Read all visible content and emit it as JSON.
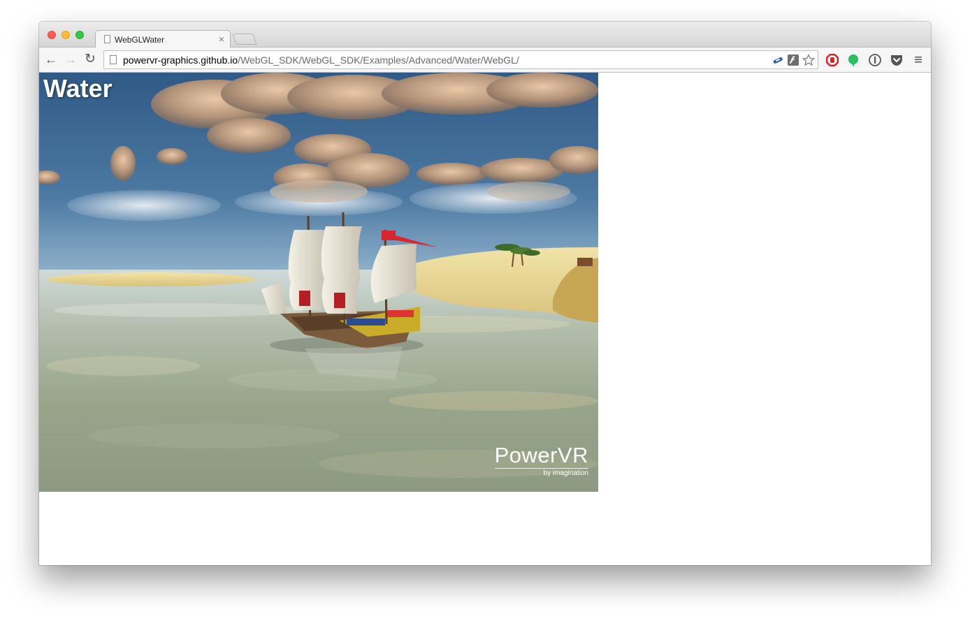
{
  "browser": {
    "tab_title": "WebGLWater",
    "tab_close": "×",
    "url_host": "powervr-graphics.github.io",
    "url_path": "/WebGL_SDK/WebGL_SDK/Examples/Advanced/Water/WebGL/",
    "nav": {
      "back": "←",
      "forward": "→",
      "reload": "↻"
    },
    "menu_glyph": "≡"
  },
  "demo": {
    "title": "Water",
    "logo_main": "PowerVR",
    "logo_sub": "by imagination"
  },
  "colors": {
    "sky_top": "#2f5b86",
    "sky_horizon": "#d7e8ef",
    "water": "#9aa890",
    "sand": "#e9d89a",
    "flag": "#d8262e"
  },
  "icons": [
    "back-arrow-icon",
    "forward-arrow-icon",
    "reload-icon",
    "page-icon",
    "link-icon",
    "flash-icon",
    "star-icon",
    "adblock-icon",
    "evernote-icon",
    "1password-icon",
    "pocket-icon",
    "menu-icon"
  ]
}
